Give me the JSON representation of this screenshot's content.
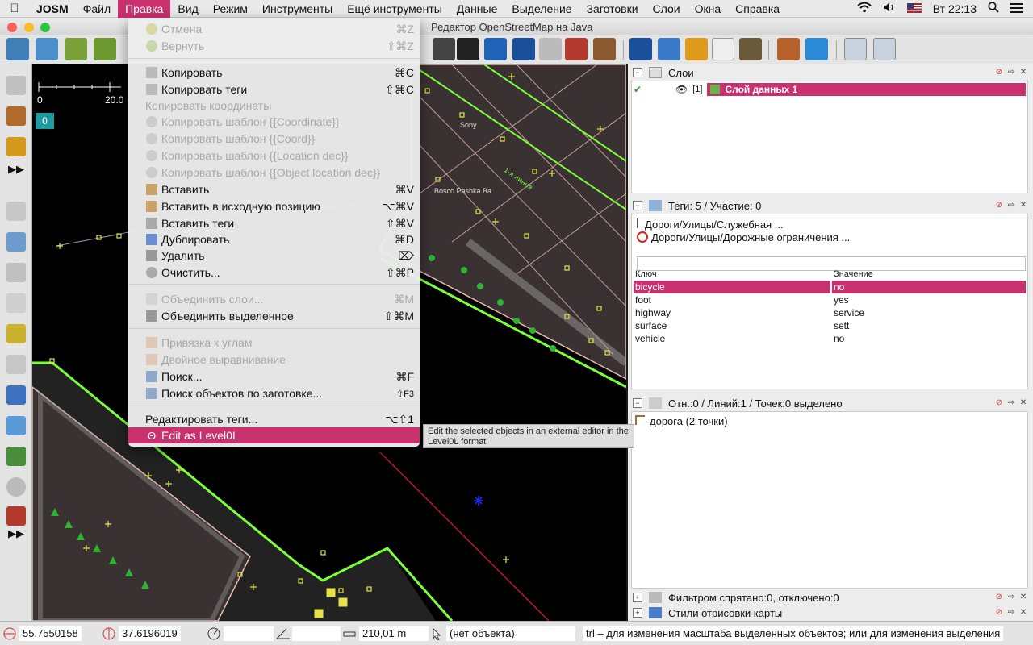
{
  "menubar": {
    "app_name": "JOSM",
    "items": [
      "Файл",
      "Правка",
      "Вид",
      "Режим",
      "Инструменты",
      "Ещё инструменты",
      "Данные",
      "Выделение",
      "Заготовки",
      "Слои",
      "Окна",
      "Справка"
    ],
    "clock": "Вт 22:13"
  },
  "window": {
    "title": "Редактор OpenStreetMap на Java"
  },
  "map": {
    "scale_start": "0",
    "scale_end": "20.0",
    "zoom_badge": "0",
    "label_sony": "Sony",
    "label_cafe": "Bosco Pashka Ba"
  },
  "edit_menu": {
    "items": [
      {
        "label": "Отмена",
        "shortcut": "⌘Z",
        "disabled": true
      },
      {
        "label": "Вернуть",
        "shortcut": "⇧⌘Z",
        "disabled": true
      },
      {
        "label": "Копировать",
        "shortcut": "⌘C",
        "disabled": false
      },
      {
        "label": "Копировать теги",
        "shortcut": "⇧⌘C",
        "disabled": false
      },
      {
        "label": "Копировать координаты",
        "shortcut": "",
        "disabled": true
      },
      {
        "label": "Копировать шаблон {{Coordinate}}",
        "shortcut": "",
        "disabled": true
      },
      {
        "label": "Копировать шаблон {{Coord}}",
        "shortcut": "",
        "disabled": true
      },
      {
        "label": "Копировать шаблон {{Location dec}}",
        "shortcut": "",
        "disabled": true
      },
      {
        "label": "Копировать шаблон {{Object location dec}}",
        "shortcut": "",
        "disabled": true
      },
      {
        "label": "Вставить",
        "shortcut": "⌘V",
        "disabled": false
      },
      {
        "label": "Вставить в исходную позицию",
        "shortcut": "⌥⌘V",
        "disabled": false
      },
      {
        "label": "Вставить теги",
        "shortcut": "⇧⌘V",
        "disabled": false
      },
      {
        "label": "Дублировать",
        "shortcut": "⌘D",
        "disabled": false
      },
      {
        "label": "Удалить",
        "shortcut": "⌦",
        "disabled": false
      },
      {
        "label": "Очистить...",
        "shortcut": "⇧⌘P",
        "disabled": false
      },
      {
        "label": "Объединить слои...",
        "shortcut": "⌘M",
        "disabled": true
      },
      {
        "label": "Объединить выделенное",
        "shortcut": "⇧⌘M",
        "disabled": false
      },
      {
        "label": "Привязка к углам",
        "shortcut": "",
        "disabled": true
      },
      {
        "label": "Двойное выравнивание",
        "shortcut": "",
        "disabled": true
      },
      {
        "label": "Поиск...",
        "shortcut": "⌘F",
        "disabled": false
      },
      {
        "label": "Поиск объектов по заготовке...",
        "shortcut": "⇧F3",
        "disabled": false
      },
      {
        "label": "Редактировать теги...",
        "shortcut": "⌥⇧1",
        "disabled": false
      },
      {
        "label": "Edit as Level0L",
        "shortcut": "",
        "disabled": false,
        "highlighted": true
      }
    ]
  },
  "tooltip": "Edit the selected objects in an external editor in the Level0L format",
  "layers_panel": {
    "title": "Слои",
    "layer_index": "[1]",
    "layer_name": "Слой данных 1"
  },
  "tags_panel": {
    "title": "Теги: 5 / Участие: 0",
    "preset1": "Дороги/Улицы/Служебная ...",
    "preset2": "Дороги/Улицы/Дорожные ограничения ...",
    "col_key": "Ключ",
    "col_value": "Значение",
    "rows": [
      {
        "key": "bicycle",
        "value": "no"
      },
      {
        "key": "foot",
        "value": "yes"
      },
      {
        "key": "highway",
        "value": "service"
      },
      {
        "key": "surface",
        "value": "sett"
      },
      {
        "key": "vehicle",
        "value": "no"
      }
    ]
  },
  "selection_panel": {
    "title": "Отн.:0 / Линий:1 / Точек:0 выделено",
    "item": "дорога (2 точки)"
  },
  "filter_panel": {
    "title": "Фильтром спрятано:0, отключено:0"
  },
  "styles_panel": {
    "title": "Стили отрисовки карты"
  },
  "statusbar": {
    "lat": "55.7550158",
    "lon": "37.6196019",
    "distance": "210,01 m",
    "object": "(нет объекта)",
    "help": "trl – для изменения масштаба выделенных объектов; или для изменения выделения"
  }
}
